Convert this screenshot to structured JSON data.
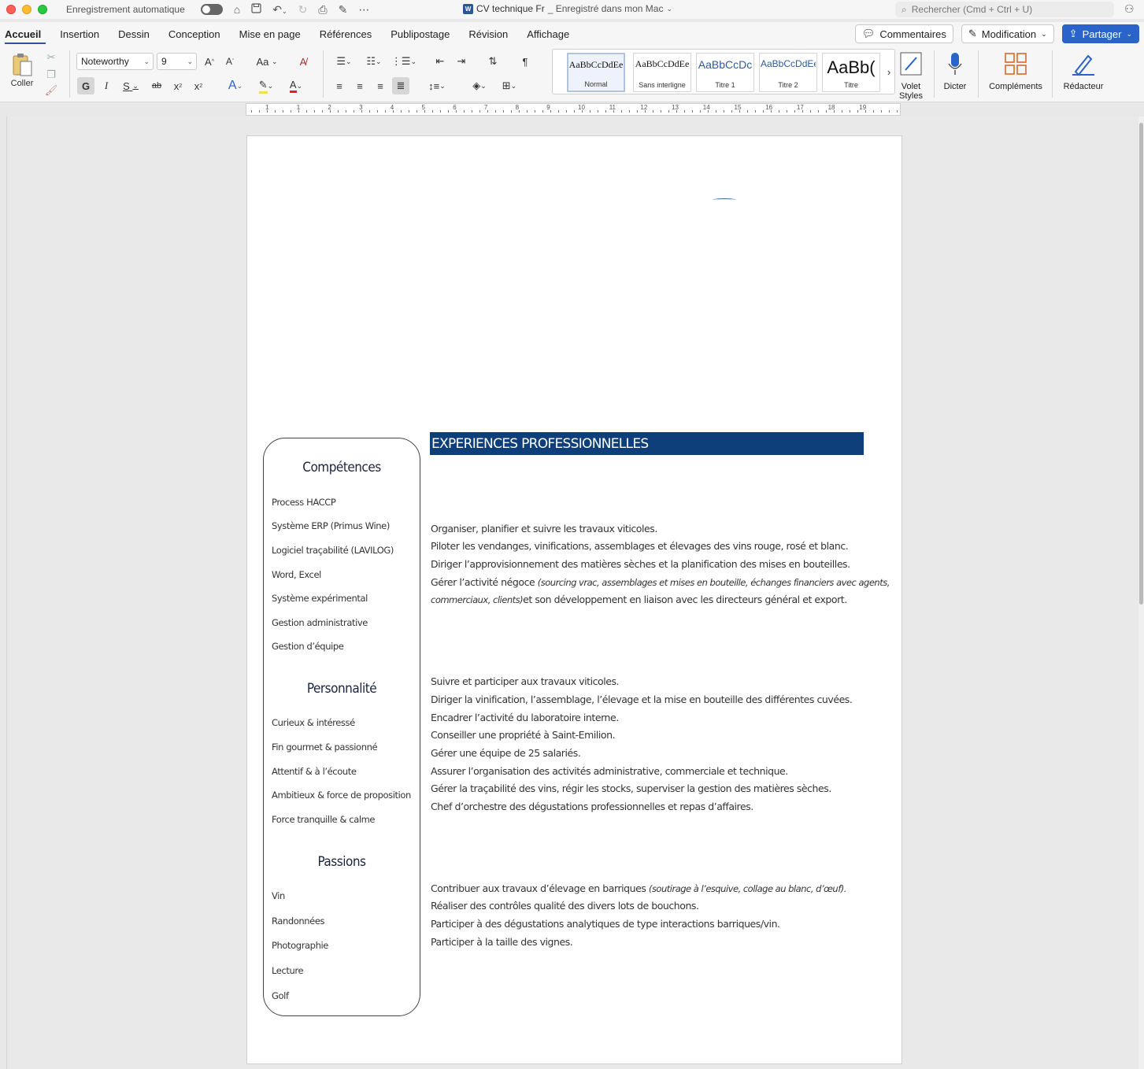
{
  "titlebar": {
    "autosave_label": "Enregistrement automatique",
    "doc_title": "CV technique Fr",
    "doc_status": "_ Enregistré dans mon Mac",
    "search_placeholder": "Rechercher (Cmd + Ctrl + U)"
  },
  "tabs": [
    "Accueil",
    "Insertion",
    "Dessin",
    "Conception",
    "Mise en page",
    "Références",
    "Publipostage",
    "Révision",
    "Affichage"
  ],
  "right_buttons": {
    "comments": "Commentaires",
    "editing": "Modification",
    "share": "Partager"
  },
  "toolbar": {
    "paste_label": "Coller",
    "font_name": "Noteworthy",
    "font_size": "9",
    "bold_glyph": "G",
    "italic_glyph": "I",
    "underline_glyph": "S",
    "strike_glyph": "ab",
    "case_label": "Aa",
    "pilcrow": "¶",
    "styles": [
      {
        "preview": "AaBbCcDdEe",
        "label": "Normal"
      },
      {
        "preview": "AaBbCcDdEe",
        "label": "Sans interligne"
      },
      {
        "preview": "AaBbCcDc",
        "label": "Titre 1"
      },
      {
        "preview": "AaBbCcDdEe",
        "label": "Titre 2"
      },
      {
        "preview": "AaBb(",
        "label": "Titre"
      }
    ],
    "volet_label": "Volet Styles",
    "dictate_label": "Dicter",
    "addins_label": "Compléments",
    "editor_label": "Rédacteur"
  },
  "ruler_numbers": [
    "1",
    "1",
    "2",
    "3",
    "4",
    "5",
    "6",
    "7",
    "8",
    "9",
    "10",
    "11",
    "12",
    "13",
    "14",
    "15",
    "16",
    "17",
    "18",
    "19"
  ],
  "document": {
    "sidebar": {
      "competences_title": "Compétences",
      "competences": [
        "Process HACCP",
        "Système ERP (Primus Wine)",
        "Logiciel traçabilité (LAVILOG)",
        "Word, Excel",
        "Système expérimental",
        "Gestion administrative",
        "Gestion d’équipe"
      ],
      "personnalite_title": "Personnalité",
      "personnalite": [
        "Curieux & intéressé",
        "Fin gourmet & passionné",
        "Attentif & à l’écoute",
        "Ambitieux & force de proposition",
        "Force tranquille & calme"
      ],
      "passions_title": "Passions",
      "passions": [
        "Vin",
        "Randonnées",
        "Photographie",
        "Lecture",
        "Golf"
      ]
    },
    "experience_header": "EXPERIENCES PROFESSIONNELLES",
    "block1": [
      "Organiser, planifier et suivre les travaux viticoles.",
      "Piloter les vendanges, vinifications, assemblages et élevages des vins rouge, rosé et blanc.",
      "Diriger l’approvisionnement des matières sèches et la planification des mises en bouteilles."
    ],
    "block1_negoce": {
      "start": "Gérer l’activité négoce ",
      "italic1": "(sourcing vrac, assemblages et mises en bouteille, échanges financiers avec agents,",
      "italic2": "commerciaux, clients)",
      "end": "et son développement en liaison avec les directeurs général et export."
    },
    "block2": [
      "Suivre et participer aux travaux viticoles.",
      "Diriger la vinification, l’assemblage, l’élevage et la mise en bouteille des différentes cuvées.",
      "Encadrer l’activité du laboratoire interne.",
      "Conseiller une propriété à Saint-Emilion.",
      "Gérer une équipe de 25 salariés.",
      "Assurer l’organisation des activités administrative, commerciale et technique.",
      "Gérer la traçabilité des vins, régir les stocks, superviser la gestion des matières sèches.",
      "Chef d’orchestre des dégustations professionnelles et repas d’affaires."
    ],
    "block3_first": {
      "start": "Contribuer aux travaux d’élevage en barriques ",
      "italic": "(soutirage à l’esquive, collage au blanc, d’œuf)."
    },
    "block3": [
      "Réaliser des contrôles qualité des divers lots de bouchons.",
      "Participer à des dégustations analytiques de type interactions barriques/vin.",
      "Participer à la taille des vignes."
    ]
  }
}
